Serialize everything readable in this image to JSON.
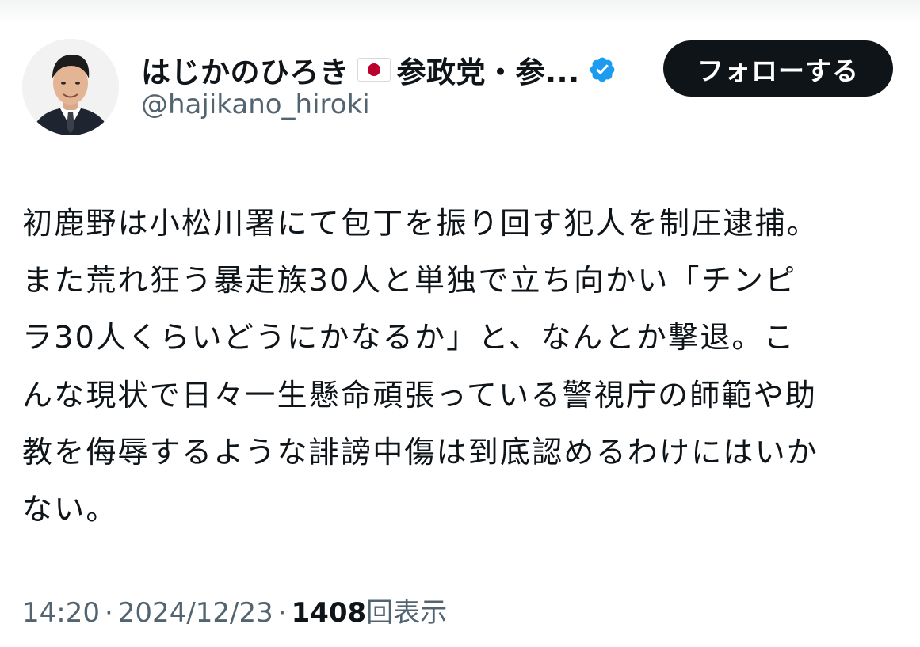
{
  "author": {
    "display_name": "はじかのひろき",
    "display_name_suffix": "参政党・参...",
    "flag_icon": "japan-flag-icon",
    "verified_icon": "verified-badge-icon",
    "verified_color": "#1d9bf0",
    "handle": "@hajikano_hiroki"
  },
  "follow_button": {
    "label": "フォローする"
  },
  "tweet": {
    "lines": [
      "初鹿野は小松川署にて包丁を振り回す犯人を制圧逮捕。",
      "また荒れ狂う暴走族30人と単独で立ち向かい「チンピ",
      "ラ30人くらいどうにかなるか」と、なんとか撃退。こ",
      "んな現状で日々一生懸命頑張っている警視庁の師範や助",
      "教を侮辱するような誹謗中傷は到底認めるわけにはいか",
      "ない。"
    ]
  },
  "meta": {
    "time": "14:20",
    "separator": "·",
    "date": "2024/12/23",
    "views_count": "1408",
    "views_label": "回表示"
  },
  "colors": {
    "text": "#0f1419",
    "secondary": "#536471",
    "button_bg": "#0f1419",
    "button_text": "#ffffff",
    "flag_red": "#bc002d"
  }
}
